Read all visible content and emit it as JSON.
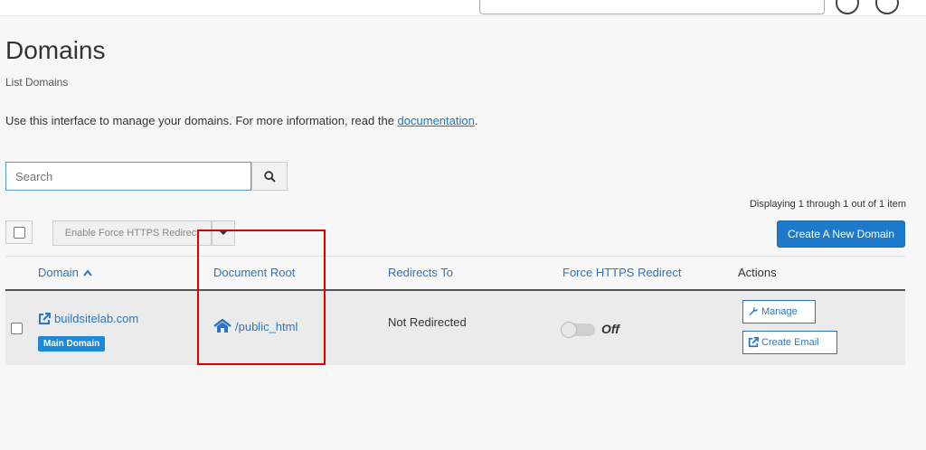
{
  "header": {
    "title": "Domains",
    "subtitle": "List Domains"
  },
  "info": {
    "text": "Use this interface to manage your domains. For more information, read the ",
    "link_label": "documentation",
    "suffix": "."
  },
  "search": {
    "placeholder": "Search",
    "button_icon": "search-icon"
  },
  "pagination": {
    "display_text": "Displaying 1 through 1 out of 1 item"
  },
  "toolbar": {
    "force_https_label": "Enable Force HTTPS Redirect",
    "create_label": "Create A New Domain"
  },
  "table": {
    "columns": [
      "Domain",
      "Document Root",
      "Redirects To",
      "Force HTTPS Redirect",
      "Actions"
    ],
    "sort_indicator": "chevron-up-icon",
    "rows": [
      {
        "domain": "buildsitelab.com",
        "badge": "Main Domain",
        "document_root": "/public_html",
        "redirects_to": "Not Redirected",
        "force_https": "Off",
        "actions": [
          "Manage",
          "Create Email"
        ]
      }
    ]
  },
  "colors": {
    "link": "#2a76c4",
    "primary_button": "#1d79c9",
    "badge": "#1d88d6",
    "highlight": "#e00000"
  }
}
